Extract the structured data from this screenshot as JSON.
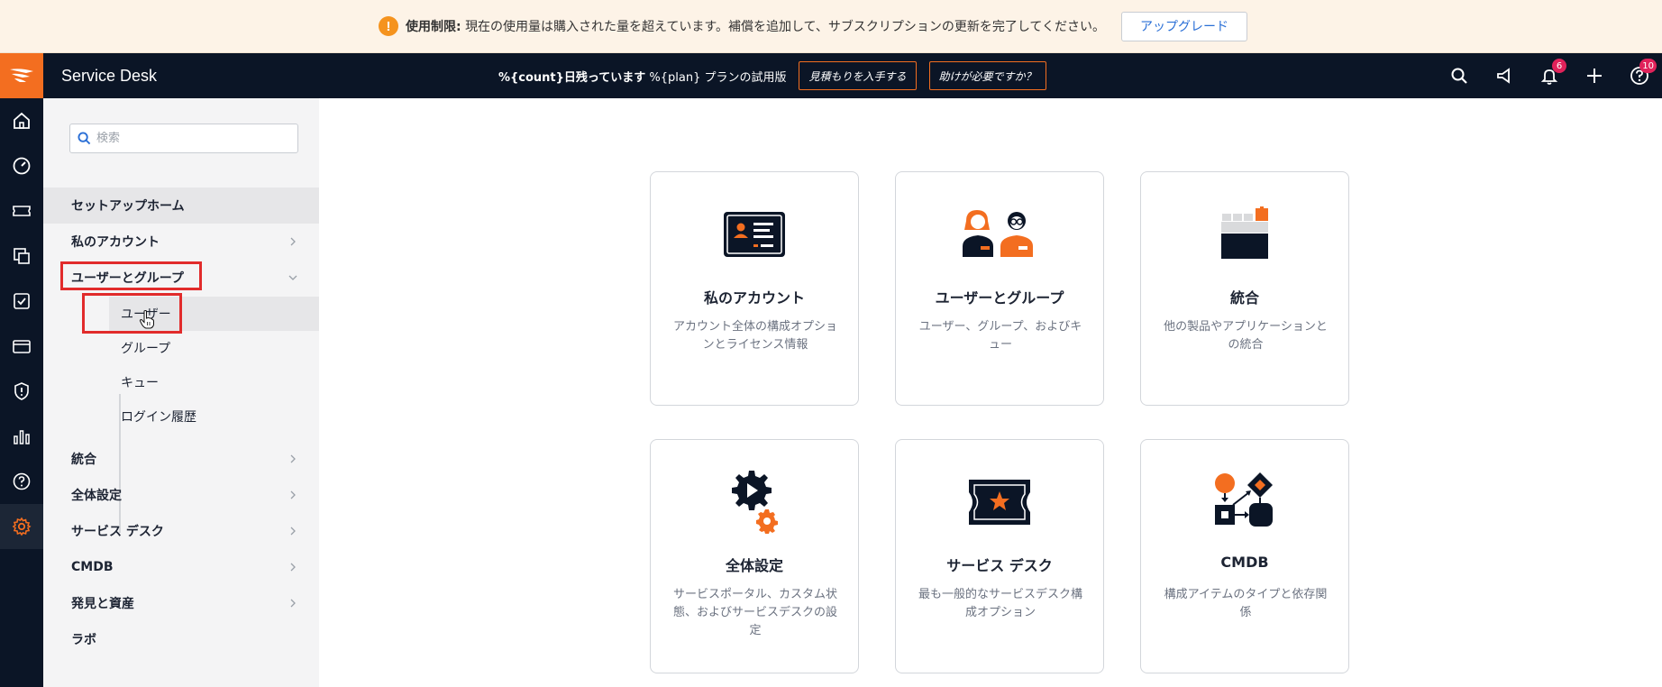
{
  "banner": {
    "label": "使用制限:",
    "message": "現在の使用量は購入された量を超えています。補償を追加して、サブスクリプションの更新を完了してください。",
    "upgrade_label": "アップグレード",
    "icon": "warning-icon"
  },
  "topbar": {
    "app_title": "Service Desk",
    "trial_bold": "%{count}日残っています",
    "trial_plain": " %{plan} プランの試用版",
    "quote_button": "見積もりを入手する",
    "help_button": "助けが必要ですか？",
    "notifications_count": "6",
    "help_count": "10",
    "accent_color": "#f36e20"
  },
  "sidebar": {
    "search_placeholder": "検索",
    "items": {
      "setup_home": "セットアップホーム",
      "my_account": "私のアカウント",
      "users_groups": "ユーザーとグループ",
      "integrations": "統合",
      "global_settings": "全体設定",
      "service_desk": "サービス デスク",
      "cmdb": "CMDB",
      "discovery": "発見と資産",
      "labs": "ラボ"
    },
    "sub_items": {
      "users": "ユーザー",
      "groups": "グループ",
      "queues": "キュー",
      "login_history": "ログイン履歴"
    }
  },
  "cards": [
    {
      "title": "私のアカウント",
      "desc": "アカウント全体の構成オプションとライセンス情報",
      "icon": "id-card-icon"
    },
    {
      "title": "ユーザーとグループ",
      "desc": "ユーザー、グループ、およびキュー",
      "icon": "users-icon"
    },
    {
      "title": "統合",
      "desc": "他の製品やアプリケーションとの統合",
      "icon": "blocks-icon"
    },
    {
      "title": "全体設定",
      "desc": "サービスポータル、カスタム状態、およびサービスデスクの設定",
      "icon": "gear-play-icon"
    },
    {
      "title": "サービス デスク",
      "desc": "最も一般的なサービスデスク構成オプション",
      "icon": "ticket-star-icon"
    },
    {
      "title": "CMDB",
      "desc": "構成アイテムのタイプと依存関係",
      "icon": "flowchart-icon"
    }
  ]
}
